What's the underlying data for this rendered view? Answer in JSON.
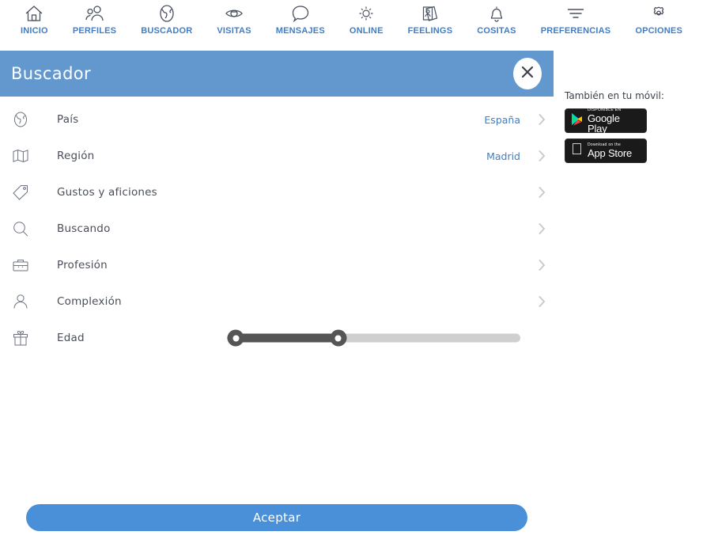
{
  "topnav": {
    "items": [
      {
        "label": "INICIO",
        "icon": "home-icon"
      },
      {
        "label": "PERFILES",
        "icon": "people-icon"
      },
      {
        "label": "BUSCADOR",
        "icon": "globe-icon"
      },
      {
        "label": "VISITAS",
        "icon": "eye-icon"
      },
      {
        "label": "MENSAJES",
        "icon": "chat-bubble-icon"
      },
      {
        "label": "ONLINE",
        "icon": "sun-icon"
      },
      {
        "label": "FEELINGS",
        "icon": "cards-icon"
      },
      {
        "label": "COSITAS",
        "icon": "bell-icon"
      },
      {
        "label": "PREFERENCIAS",
        "icon": "filter-icon"
      },
      {
        "label": "OPCIONES",
        "icon": "gear-icon"
      }
    ],
    "label_color": "#3f7ec6",
    "icon_color": "#4a5160"
  },
  "panel": {
    "title": "Buscador",
    "header_color": "#6398cf",
    "close_icon": "close-icon",
    "rows": [
      {
        "label": "País",
        "value": "España",
        "icon": "globe-icon",
        "chevron": "chevron-right-icon"
      },
      {
        "label": "Región",
        "value": "Madrid",
        "icon": "map-icon",
        "chevron": "chevron-right-icon"
      },
      {
        "label": "Gustos y aficiones",
        "value": "",
        "icon": "tag-icon",
        "chevron": "chevron-right-icon"
      },
      {
        "label": "Buscando",
        "value": "",
        "icon": "search-icon",
        "chevron": "chevron-right-icon"
      },
      {
        "label": "Profesión",
        "value": "",
        "icon": "briefcase-icon",
        "chevron": "chevron-right-icon"
      },
      {
        "label": "Complexión",
        "value": "",
        "icon": "person-icon",
        "chevron": "chevron-right-icon"
      }
    ],
    "age_row": {
      "label": "Edad",
      "icon": "gift-icon",
      "slider": {
        "min_handle_percent": 3,
        "max_handle_percent": 38,
        "fill_color": "#555555",
        "track_color": "#cfcfcf"
      }
    },
    "accept_label": "Aceptar",
    "accept_color": "#4a90d9"
  },
  "sidebar": {
    "title": "También en tu móvil:",
    "badges": [
      {
        "small": "DISPONIBLE EN",
        "big": "Google Play",
        "icon": "google-play-icon"
      },
      {
        "small": "Download on the",
        "big": "App Store",
        "icon": "apple-icon"
      }
    ]
  }
}
